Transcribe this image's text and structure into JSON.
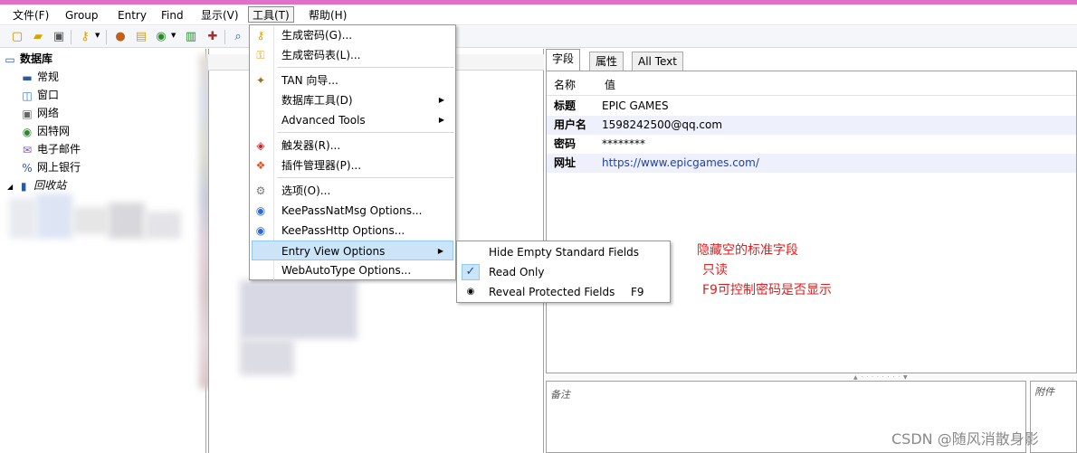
{
  "menubar": {
    "items": [
      "文件(F)",
      "Group",
      "Entry",
      "Find",
      "显示(V)",
      "工具(T)",
      "帮助(H)"
    ]
  },
  "toolbar": {
    "icons": [
      "new-icon",
      "open-icon",
      "save-icon",
      "key-add-icon",
      "user-icon",
      "note-icon",
      "globe-icon",
      "copy-icon",
      "sync-icon",
      "search-icon"
    ]
  },
  "tree": {
    "root": "数据库",
    "items": [
      "常规",
      "窗口",
      "网络",
      "因特网",
      "电子邮件",
      "网上银行",
      "回收站"
    ]
  },
  "tabs": [
    "字段",
    "属性",
    "All Text"
  ],
  "fields": {
    "header": {
      "name": "名称",
      "value": "值"
    },
    "rows": [
      {
        "key": "标题",
        "value": "EPIC GAMES"
      },
      {
        "key": "用户名",
        "value": "1598242500@qq.com"
      },
      {
        "key": "密码",
        "value": "********"
      },
      {
        "key": "网址",
        "value": "https://www.epicgames.com/"
      }
    ]
  },
  "notes_label": "备注",
  "attach_label": "附件",
  "tools_menu": {
    "items": [
      {
        "label": "生成密码(G)...",
        "icon": "key-gen-icon"
      },
      {
        "label": "生成密码表(L)...",
        "icon": "key-list-icon"
      },
      {
        "label": "TAN 向导...",
        "icon": "wand-icon"
      },
      {
        "label": "数据库工具(D)",
        "icon": ""
      },
      {
        "label": "Advanced Tools",
        "icon": ""
      },
      {
        "label": "触发器(R)...",
        "icon": "trigger-icon"
      },
      {
        "label": "插件管理器(P)...",
        "icon": "plugin-icon"
      },
      {
        "label": "选项(O)...",
        "icon": "gear-icon"
      },
      {
        "label": "KeePassNatMsg Options...",
        "icon": "globe-icon"
      },
      {
        "label": "KeePassHttp Options...",
        "icon": "globe-icon"
      },
      {
        "label": "Entry View Options",
        "icon": ""
      },
      {
        "label": "WebAutoType Options...",
        "icon": ""
      }
    ]
  },
  "entry_view_submenu": {
    "items": [
      {
        "label": "Hide Empty Standard Fields",
        "shortcut": "",
        "checked": false
      },
      {
        "label": "Read Only",
        "shortcut": "",
        "checked": true
      },
      {
        "label": "Reveal Protected Fields",
        "shortcut": "F9",
        "checked": false
      }
    ]
  },
  "annotations": [
    "隐藏空的标准字段",
    "只读",
    "F9可控制密码是否显示"
  ],
  "colors": {
    "annotation": "#e02020",
    "highlight": "#cce4f7",
    "link": "#1a3fb0"
  },
  "watermark": "CSDN @随风消散身影"
}
